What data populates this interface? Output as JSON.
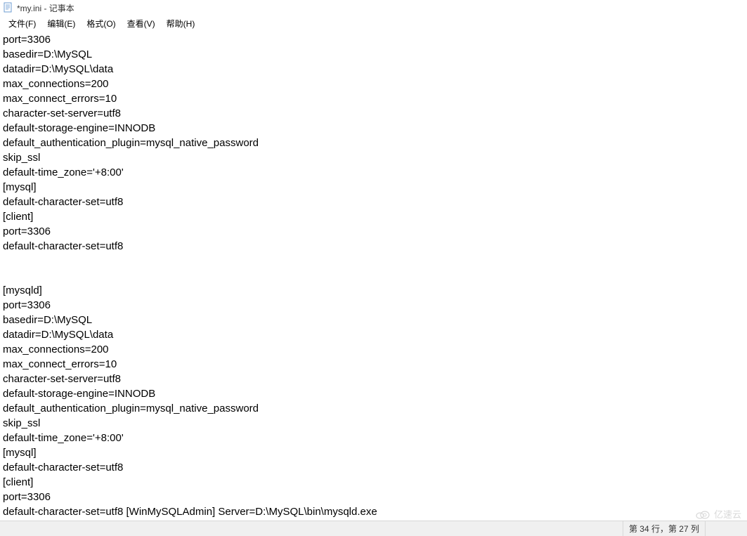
{
  "window": {
    "title": "*my.ini - 记事本"
  },
  "menu": {
    "file": "文件(F)",
    "edit": "编辑(E)",
    "format": "格式(O)",
    "view": "查看(V)",
    "help": "帮助(H)"
  },
  "content": {
    "lines": [
      "port=3306",
      "basedir=D:\\MySQL",
      "datadir=D:\\MySQL\\data",
      "max_connections=200",
      "max_connect_errors=10",
      "character-set-server=utf8",
      "default-storage-engine=INNODB",
      "default_authentication_plugin=mysql_native_password",
      "skip_ssl",
      "default-time_zone='+8:00'",
      "[mysql]",
      "default-character-set=utf8",
      "[client]",
      "port=3306",
      "default-character-set=utf8",
      "",
      "",
      "[mysqld]",
      "port=3306",
      "basedir=D:\\MySQL",
      "datadir=D:\\MySQL\\data",
      "max_connections=200",
      "max_connect_errors=10",
      "character-set-server=utf8",
      "default-storage-engine=INNODB",
      "default_authentication_plugin=mysql_native_password",
      "skip_ssl",
      "default-time_zone='+8:00'",
      "[mysql]",
      "default-character-set=utf8",
      "[client]",
      "port=3306",
      "default-character-set=utf8 [WinMySQLAdmin] Server=D:\\MySQL\\bin\\mysqld.exe"
    ]
  },
  "status": {
    "position": "第 34 行，第 27 列"
  },
  "watermark": {
    "text": "亿速云"
  }
}
